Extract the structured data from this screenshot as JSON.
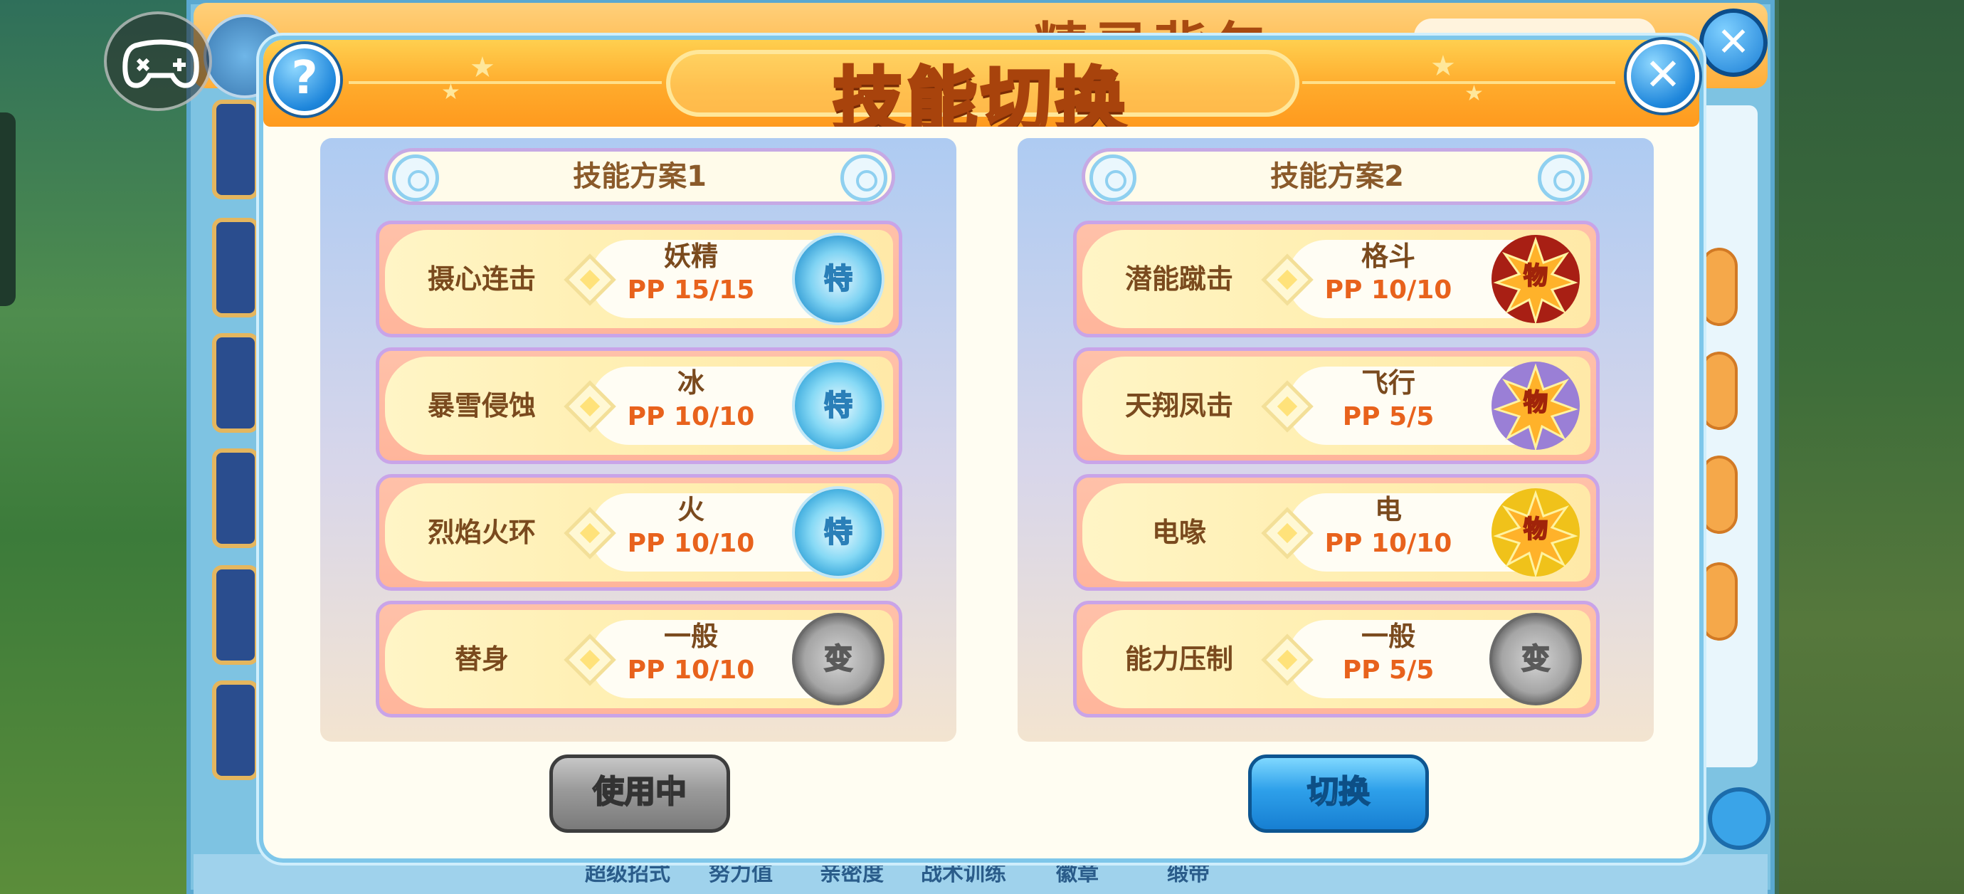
{
  "background": {
    "header_title": "精灵背包",
    "bottom_tabs": [
      "超级招式",
      "努力值",
      "亲密度",
      "战术训练",
      "徽章",
      "缎带"
    ]
  },
  "dialog": {
    "title": "技能切换",
    "help_label": "?",
    "close_label": "✕"
  },
  "plans": [
    {
      "title": "技能方案1",
      "button_label": "使用中",
      "skills": [
        {
          "name": "摄心连击",
          "type": "妖精",
          "pp": "PP 15/15",
          "badge": "特",
          "badge_kind": "special",
          "badge_color": "#d96aa8"
        },
        {
          "name": "暴雪侵蚀",
          "type": "冰",
          "pp": "PP 10/10",
          "badge": "特",
          "badge_kind": "special",
          "badge_color": "#bfe8a0"
        },
        {
          "name": "烈焰火环",
          "type": "火",
          "pp": "PP 10/10",
          "badge": "特",
          "badge_kind": "special",
          "badge_color": "#f07a2e"
        },
        {
          "name": "替身",
          "type": "一般",
          "pp": "PP 10/10",
          "badge": "变",
          "badge_kind": "change",
          "badge_color": "#a5a5a5"
        }
      ]
    },
    {
      "title": "技能方案2",
      "button_label": "切换",
      "skills": [
        {
          "name": "潜能蹴击",
          "type": "格斗",
          "pp": "PP 10/10",
          "badge": "物",
          "badge_kind": "physical",
          "badge_color": "#c8241a"
        },
        {
          "name": "天翔凤击",
          "type": "飞行",
          "pp": "PP 5/5",
          "badge": "物",
          "badge_kind": "physical",
          "badge_color": "#9a7fd6"
        },
        {
          "name": "电喙",
          "type": "电",
          "pp": "PP 10/10",
          "badge": "物",
          "badge_kind": "physical",
          "badge_color": "#f0c21a"
        },
        {
          "name": "能力压制",
          "type": "一般",
          "pp": "PP 5/5",
          "badge": "变",
          "badge_kind": "change",
          "badge_color": "#a5a5a5"
        }
      ]
    }
  ],
  "colors": {
    "header_orange": "#ffaa2b",
    "plan_panel_blue": "#aecbf2",
    "pp_text": "#e8621c",
    "switch_button": "#2ea0ea",
    "used_button": "#9a9a9a"
  }
}
